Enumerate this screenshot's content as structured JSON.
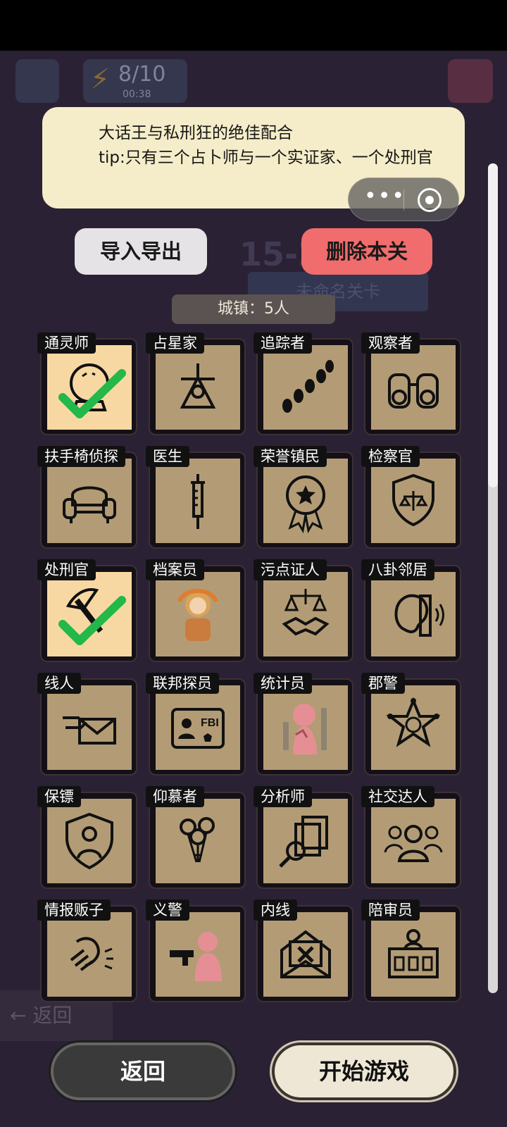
{
  "notice": {
    "title": "大话王与私刑狂的绝佳配合",
    "tip": "tip:只有三个占卜师与一个实证家、一个处刑官"
  },
  "background": {
    "energy": "8/10",
    "timer": "00:38",
    "level": "15-2",
    "unnamed": "未命名关卡",
    "back": "返回"
  },
  "capsule": {
    "more": "•••"
  },
  "buttons": {
    "import_export": "导入导出",
    "delete_level": "删除本关",
    "back": "返回",
    "start_game": "开始游戏"
  },
  "town_label": "城镇：5人",
  "roles": [
    {
      "name": "通灵师",
      "icon": "crystal-ball-icon",
      "selected": true
    },
    {
      "name": "占星家",
      "icon": "sextant-icon",
      "selected": false
    },
    {
      "name": "追踪者",
      "icon": "footprints-icon",
      "selected": false
    },
    {
      "name": "观察者",
      "icon": "binoculars-icon",
      "selected": false
    },
    {
      "name": "扶手椅侦探",
      "icon": "armchair-icon",
      "selected": false
    },
    {
      "name": "医生",
      "icon": "syringe-icon",
      "selected": false
    },
    {
      "name": "荣誉镇民",
      "icon": "medal-icon",
      "selected": false
    },
    {
      "name": "检察官",
      "icon": "justice-badge-icon",
      "selected": false
    },
    {
      "name": "处刑官",
      "icon": "axe-icon",
      "selected": true
    },
    {
      "name": "档案员",
      "icon": "archivist-portrait-icon",
      "selected": false
    },
    {
      "name": "污点证人",
      "icon": "scales-handshake-icon",
      "selected": false
    },
    {
      "name": "八卦邻居",
      "icon": "ear-icon",
      "selected": false
    },
    {
      "name": "线人",
      "icon": "envelope-hand-icon",
      "selected": false
    },
    {
      "name": "联邦探员",
      "icon": "fbi-badge-icon",
      "selected": false
    },
    {
      "name": "统计员",
      "icon": "statistician-figure-icon",
      "selected": false
    },
    {
      "name": "郡警",
      "icon": "sheriff-star-icon",
      "selected": false
    },
    {
      "name": "保镖",
      "icon": "shield-person-icon",
      "selected": false
    },
    {
      "name": "仰慕者",
      "icon": "roses-icon",
      "selected": false
    },
    {
      "name": "分析师",
      "icon": "documents-magnifier-icon",
      "selected": false
    },
    {
      "name": "社交达人",
      "icon": "group-people-icon",
      "selected": false
    },
    {
      "name": "情报贩子",
      "icon": "whisper-hand-icon",
      "selected": false
    },
    {
      "name": "义警",
      "icon": "gun-figure-icon",
      "selected": false
    },
    {
      "name": "内线",
      "icon": "envelope-x-icon",
      "selected": false
    },
    {
      "name": "陪审员",
      "icon": "jury-box-icon",
      "selected": false
    }
  ]
}
